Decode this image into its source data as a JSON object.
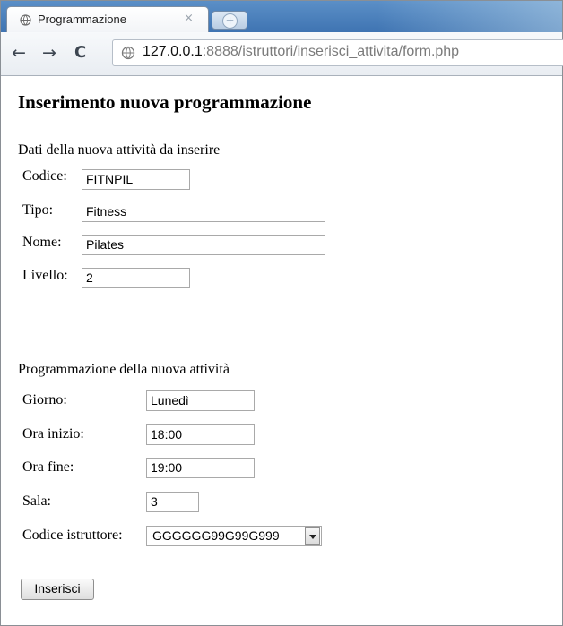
{
  "browser": {
    "tab_title": "Programmazione",
    "tab_close": "×",
    "back_glyph": "←",
    "forward_glyph": "→",
    "reload_glyph": "C",
    "url_host": "127.0.0.1",
    "url_rest": ":8888/istruttori/inserisci_attivita/form.php"
  },
  "page": {
    "heading": "Inserimento nuova programmazione",
    "activity_section": {
      "title": "Dati della nuova attività da inserire",
      "fields": [
        {
          "label": "Codice:",
          "value": "FITNPIL"
        },
        {
          "label": "Tipo:",
          "value": "Fitness"
        },
        {
          "label": "Nome:",
          "value": "Pilates"
        },
        {
          "label": "Livello:",
          "value": "2"
        }
      ]
    },
    "schedule_section": {
      "title": "Programmazione della nuova attività",
      "fields": [
        {
          "label": "Giorno:",
          "value": "Lunedì"
        },
        {
          "label": "Ora inizio:",
          "value": "18:00"
        },
        {
          "label": "Ora fine:",
          "value": "19:00"
        },
        {
          "label": "Sala:",
          "value": "3"
        }
      ],
      "instructor_label": "Codice istruttore:",
      "instructor_selected": "GGGGGG99G99G999"
    },
    "submit_label": "Inserisci"
  }
}
